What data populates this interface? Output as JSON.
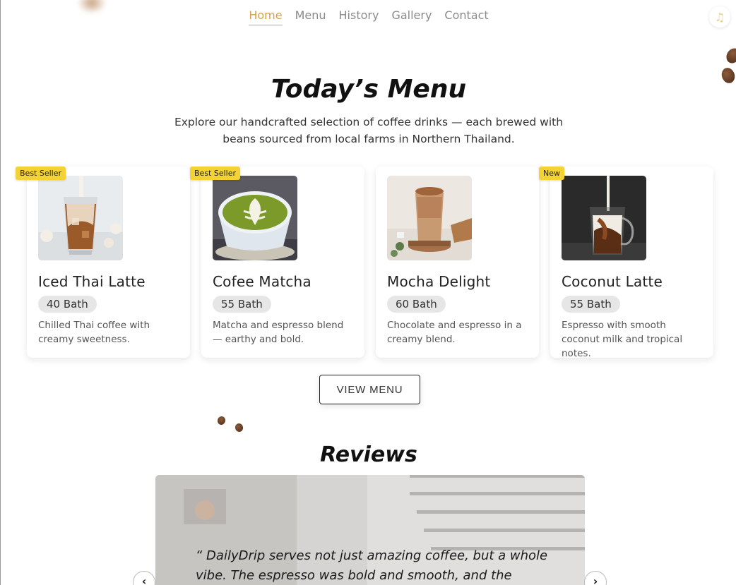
{
  "nav": {
    "items": [
      {
        "label": "Home",
        "active": true
      },
      {
        "label": "Menu",
        "active": false
      },
      {
        "label": "History",
        "active": false
      },
      {
        "label": "Gallery",
        "active": false
      },
      {
        "label": "Contact",
        "active": false
      }
    ],
    "music_icon": "music-note-icon"
  },
  "menu": {
    "title": "Today’s Menu",
    "description": "Explore our handcrafted selection of coffee drinks — each brewed with beans sourced from local farms in Northern Thailand.",
    "items": [
      {
        "badge": "Best Seller",
        "name": "Iced Thai Latte",
        "price": "40 Bath",
        "description": "Chilled Thai coffee with creamy sweetness."
      },
      {
        "badge": "Best Seller",
        "name": "Cofee Matcha",
        "price": "55 Bath",
        "description": "Matcha and espresso blend — earthy and bold."
      },
      {
        "badge": "",
        "name": "Mocha Delight",
        "price": "60 Bath",
        "description": "Chocolate and espresso in a creamy blend."
      },
      {
        "badge": "New",
        "name": "Coconut Latte",
        "price": "55 Bath",
        "description": "Espresso with smooth coconut milk and tropical notes."
      }
    ],
    "view_button": "VIEW MENU"
  },
  "reviews": {
    "title": "Reviews",
    "quote": "“ DailyDrip serves not just amazing coffee, but a whole vibe. The espresso was bold and smooth, and the space",
    "prev_icon": "chevron-left-icon",
    "next_icon": "chevron-right-icon"
  },
  "colors": {
    "accent": "#d4a24c",
    "badge": "#f4d235",
    "nav_text": "#8a8a8a"
  }
}
